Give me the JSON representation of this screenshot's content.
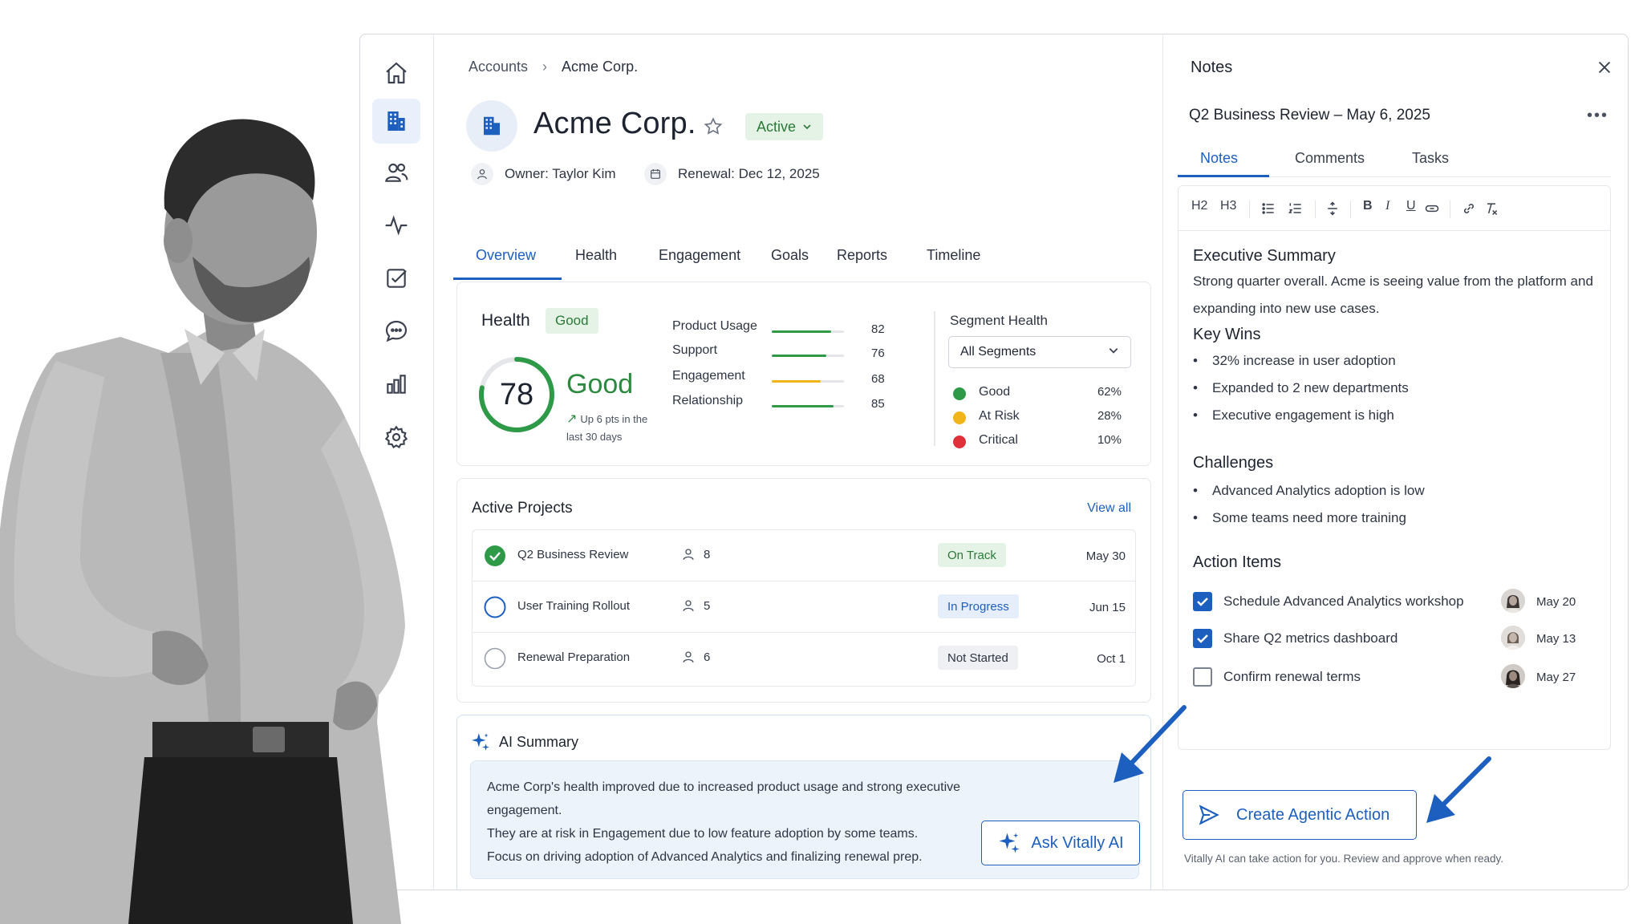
{
  "breadcrumb": {
    "root": "Accounts",
    "current": "Acme Corp."
  },
  "account": {
    "name": "Acme Corp.",
    "status": "Active",
    "owner_label": "Owner:",
    "owner": "Taylor Kim",
    "renewal_label": "Renewal:",
    "renewal": "Dec 12, 2025"
  },
  "tabs": [
    "Overview",
    "Health",
    "Engagement",
    "Goals",
    "Reports",
    "Timeline"
  ],
  "health": {
    "title": "Health",
    "badge": "Good",
    "score": "78",
    "score_value": 78,
    "label": "Good",
    "trend": "Up 6 pts in the last 30 days",
    "metrics": [
      {
        "label": "Product Usage",
        "value": "82",
        "fraction": 0.82,
        "color": "#2e9a48"
      },
      {
        "label": "Support",
        "value": "76",
        "fraction": 0.76,
        "color": "#2e9a48"
      },
      {
        "label": "Engagement",
        "value": "68",
        "fraction": 0.68,
        "color": "#f0b619"
      },
      {
        "label": "Relationship",
        "value": "85",
        "fraction": 0.85,
        "color": "#2e9a48"
      }
    ],
    "segment_title": "Segment Health",
    "segment_select": "All Segments",
    "segments": [
      {
        "name": "Good",
        "pct": "62%",
        "color": "#2e9a48"
      },
      {
        "name": "At Risk",
        "pct": "28%",
        "color": "#f0b619"
      },
      {
        "name": "Critical",
        "pct": "10%",
        "color": "#e0303a"
      }
    ]
  },
  "projects": {
    "title": "Active Projects",
    "view_all": "View all",
    "rows": [
      {
        "name": "Q2 Business Review",
        "people": "8",
        "status": "On Track",
        "date": "May 30"
      },
      {
        "name": "User Training Rollout",
        "people": "5",
        "status": "In Progress",
        "date": "Jun 15"
      },
      {
        "name": "Renewal Preparation",
        "people": "6",
        "status": "Not Started",
        "date": "Oct 1"
      }
    ]
  },
  "ai": {
    "title": "AI Summary",
    "lines": [
      "Acme Corp's health improved due to increased product usage and strong executive engagement.",
      "They are at risk in Engagement due to low feature adoption by some teams.",
      "Focus on driving adoption of Advanced Analytics and finalizing renewal prep."
    ],
    "ask_button": "Ask Vitally AI"
  },
  "notes": {
    "title": "Notes",
    "doc_title": "Q2 Business Review – May 6, 2025",
    "tabs": [
      "Notes",
      "Comments",
      "Tasks"
    ],
    "toolbar": {
      "h2": "H2",
      "h3": "H3",
      "bold": "B",
      "italic": "I",
      "underline": "U"
    },
    "exec_heading": "Executive Summary",
    "exec_text": "Strong quarter overall. Acme is seeing value from the platform and expanding into new use cases.",
    "wins_heading": "Key Wins",
    "wins": [
      "32% increase in user adoption",
      "Expanded to 2 new departments",
      "Executive engagement is high"
    ],
    "challenges_heading": "Challenges",
    "challenges": [
      "Advanced Analytics adoption is low",
      "Some teams need more training"
    ],
    "actions_heading": "Action Items",
    "actions": [
      {
        "label": "Schedule Advanced Analytics workshop",
        "date": "May 20",
        "checked": true
      },
      {
        "label": "Share Q2 metrics dashboard",
        "date": "May 13",
        "checked": true
      },
      {
        "label": "Confirm renewal terms",
        "date": "May 27",
        "checked": false
      }
    ],
    "agentic_button": "Create Agentic Action",
    "agentic_note": "Vitally AI can take action for you. Review and approve when ready."
  }
}
